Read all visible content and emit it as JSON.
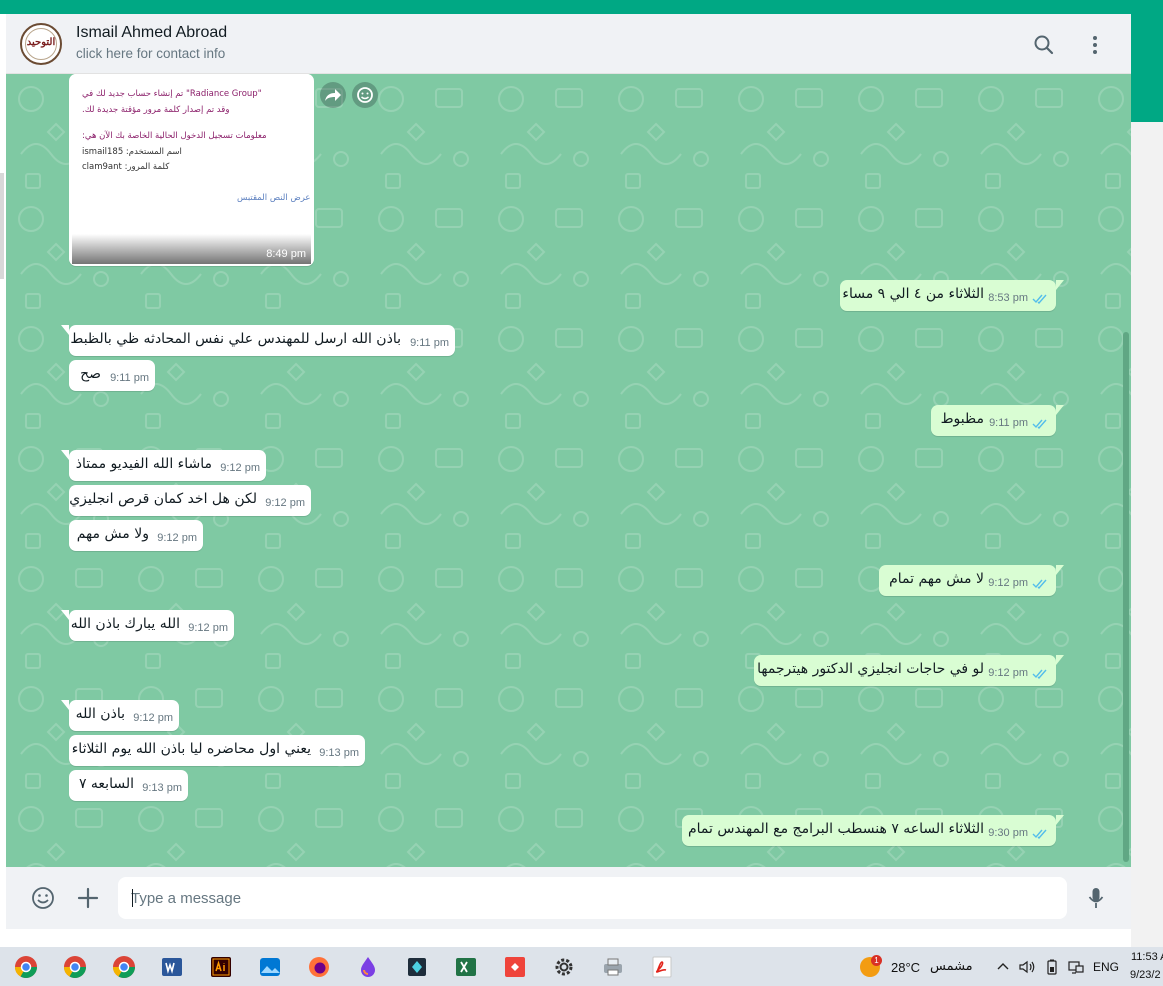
{
  "header": {
    "contact_name": "Ismail Ahmed Abroad",
    "contact_subtitle": "click here for contact info",
    "avatar_text": "التوحيد"
  },
  "image_message": {
    "lines": [
      "\"Radiance Group\" تم إنشاء حساب جديد لك في",
      "وقد تم إصدار كلمة مرور مؤقتة جديدة لك.",
      "معلومات تسجيل الدخول الحالية الخاصة بك الآن هي:",
      "اسم المستخدم: ismail185",
      "كلمة المرور: clam9ant"
    ],
    "link_text": "عرض النص المقتبس",
    "time": "8:49 pm"
  },
  "messages": [
    {
      "dir": "out",
      "text": "الثلاثاء من ٤ الي ٩ مساء",
      "time": "8:53 pm"
    },
    {
      "dir": "in",
      "text": "باذن الله ارسل للمهندس علي نفس المحادثه ظي بالظبط",
      "time": "9:11 pm"
    },
    {
      "dir": "in",
      "text": "صح",
      "time": "9:11 pm"
    },
    {
      "dir": "out",
      "text": "مظبوط",
      "time": "9:11 pm"
    },
    {
      "dir": "in",
      "text": "ماشاء الله الفيديو ممتاذ",
      "time": "9:12 pm"
    },
    {
      "dir": "in",
      "text": "لكن هل اخد كمان قرص انجليزي",
      "time": "9:12 pm"
    },
    {
      "dir": "in",
      "text": "ولا مش مهم",
      "time": "9:12 pm"
    },
    {
      "dir": "out",
      "text": "لا مش مهم تمام",
      "time": "9:12 pm"
    },
    {
      "dir": "in",
      "text": "الله يبارك باذن الله",
      "time": "9:12 pm"
    },
    {
      "dir": "out",
      "text": "لو في حاجات انجليزي الدكتور هيترجمها",
      "time": "9:12 pm"
    },
    {
      "dir": "in",
      "text": "باذن الله",
      "time": "9:12 pm"
    },
    {
      "dir": "in",
      "text": "يعني اول محاضره ليا باذن الله يوم الثلاثاء",
      "time": "9:13 pm"
    },
    {
      "dir": "in",
      "text": "السابعه ٧",
      "time": "9:13 pm"
    },
    {
      "dir": "out",
      "text": "الثلاثاء الساعه ٧ هنسطب البرامج مع المهندس تمام",
      "time": "9:30 pm"
    }
  ],
  "footer": {
    "input_placeholder": "Type a message"
  },
  "taskbar": {
    "weather_temp": "28°C",
    "weather_desc": "مشمس",
    "weather_badge": "1",
    "language": "ENG",
    "time": "11:53 A",
    "date": "9/23/2"
  },
  "colors": {
    "accent": "#00a884",
    "chat_background": "#7fc9a3",
    "incoming_bubble": "#ffffff",
    "outgoing_bubble": "#d9fdd3",
    "read_ticks": "#53bdeb"
  }
}
